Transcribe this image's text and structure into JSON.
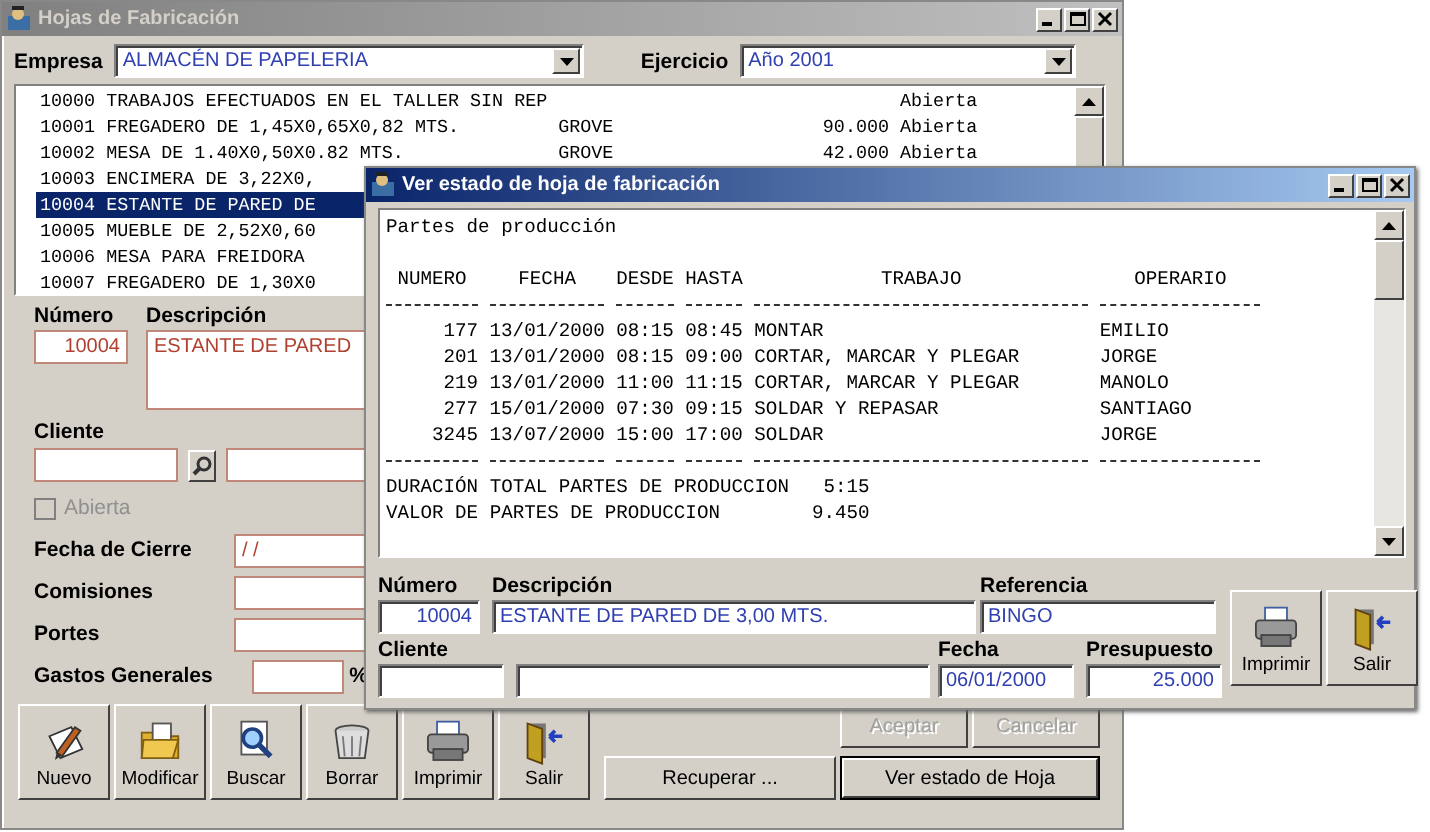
{
  "main_window": {
    "title": "Hojas de Fabricación",
    "empresa": {
      "label": "Empresa",
      "value": "ALMACÉN DE PAPELERIA"
    },
    "ejercicio": {
      "label": "Ejercicio",
      "value": "Año 2001"
    },
    "list_rows": [
      {
        "number": "10000",
        "description": "TRABAJOS EFECTUADOS EN EL TALLER SIN REP",
        "client": "",
        "amount": "",
        "status": "Abierta",
        "selected": false
      },
      {
        "number": "10001",
        "description": "FREGADERO DE 1,45X0,65X0,82 MTS.",
        "client": "GROVE",
        "amount": "90.000",
        "status": "Abierta",
        "selected": false
      },
      {
        "number": "10002",
        "description": "MESA DE 1.40X0,50X0.82 MTS.",
        "client": "GROVE",
        "amount": "42.000",
        "status": "Abierta",
        "selected": false
      },
      {
        "number": "10003",
        "description": "ENCIMERA DE 3,22X0,",
        "selected": false
      },
      {
        "number": "10004",
        "description": "ESTANTE DE PARED DE",
        "selected": true
      },
      {
        "number": "10005",
        "description": "MUEBLE DE 2,52X0,60",
        "selected": false
      },
      {
        "number": "10006",
        "description": "MESA PARA FREIDORA",
        "selected": false
      },
      {
        "number": "10007",
        "description": "FREGADERO DE 1,30X0",
        "selected": false
      }
    ],
    "form": {
      "numero": {
        "label": "Número",
        "value": "10004"
      },
      "descripcion": {
        "label": "Descripción",
        "value": "ESTANTE DE PARED"
      },
      "cliente": {
        "label": "Cliente"
      },
      "abierta": {
        "label": "Abierta",
        "checked": false,
        "disabled": true
      },
      "fecha_cierre": {
        "label": "Fecha de Cierre",
        "value": "/ /"
      },
      "comisiones": {
        "label": "Comisiones"
      },
      "portes": {
        "label": "Portes"
      },
      "gastos_generales": {
        "label": "Gastos Generales",
        "unit": "%"
      }
    },
    "toolbar": [
      {
        "label": "Nuevo",
        "kind": "new"
      },
      {
        "label": "Modificar",
        "kind": "edit"
      },
      {
        "label": "Buscar",
        "kind": "search"
      },
      {
        "label": "Borrar",
        "kind": "delete"
      },
      {
        "label": "Imprimir",
        "kind": "print"
      },
      {
        "label": "Salir",
        "kind": "exit"
      }
    ],
    "actions": [
      {
        "label": "Aceptar",
        "disabled": true,
        "default": false
      },
      {
        "label": "Cancelar",
        "disabled": true,
        "default": false
      },
      {
        "label": "Recuperar ...",
        "disabled": false,
        "default": false
      },
      {
        "label": "Ver estado de Hoja",
        "disabled": false,
        "default": true
      }
    ]
  },
  "dialog": {
    "title": "Ver estado de hoja de fabricación",
    "report": {
      "title": "Partes de producción",
      "columns": [
        "NUMERO",
        "FECHA",
        "DESDE",
        "HASTA",
        "TRABAJO",
        "OPERARIO"
      ],
      "rows": [
        [
          "177",
          "13/01/2000",
          "08:15",
          "08:45",
          "MONTAR",
          "EMILIO"
        ],
        [
          "201",
          "13/01/2000",
          "08:15",
          "09:00",
          "CORTAR, MARCAR Y PLEGAR",
          "JORGE"
        ],
        [
          "219",
          "13/01/2000",
          "11:00",
          "11:15",
          "CORTAR, MARCAR Y PLEGAR",
          "MANOLO"
        ],
        [
          "277",
          "15/01/2000",
          "07:30",
          "09:15",
          "SOLDAR Y REPASAR",
          "SANTIAGO"
        ],
        [
          "3245",
          "13/07/2000",
          "15:00",
          "17:00",
          "SOLDAR",
          "JORGE"
        ]
      ],
      "totals": [
        {
          "label": "DURACIÓN TOTAL PARTES DE PRODUCCION",
          "value": "5:15"
        },
        {
          "label": "VALOR DE PARTES DE PRODUCCION",
          "value": "9.450"
        }
      ]
    },
    "numero": {
      "label": "Número",
      "value": "10004"
    },
    "descripcion": {
      "label": "Descripción",
      "value": "ESTANTE DE PARED DE 3,00 MTS."
    },
    "referencia": {
      "label": "Referencia",
      "value": "BINGO"
    },
    "cliente": {
      "label": "Cliente"
    },
    "fecha": {
      "label": "Fecha",
      "value": "06/01/2000"
    },
    "presupuesto": {
      "label": "Presupuesto",
      "value": "25.000"
    },
    "buttons": [
      {
        "label": "Imprimir",
        "kind": "print"
      },
      {
        "label": "Salir",
        "kind": "exit"
      }
    ]
  }
}
